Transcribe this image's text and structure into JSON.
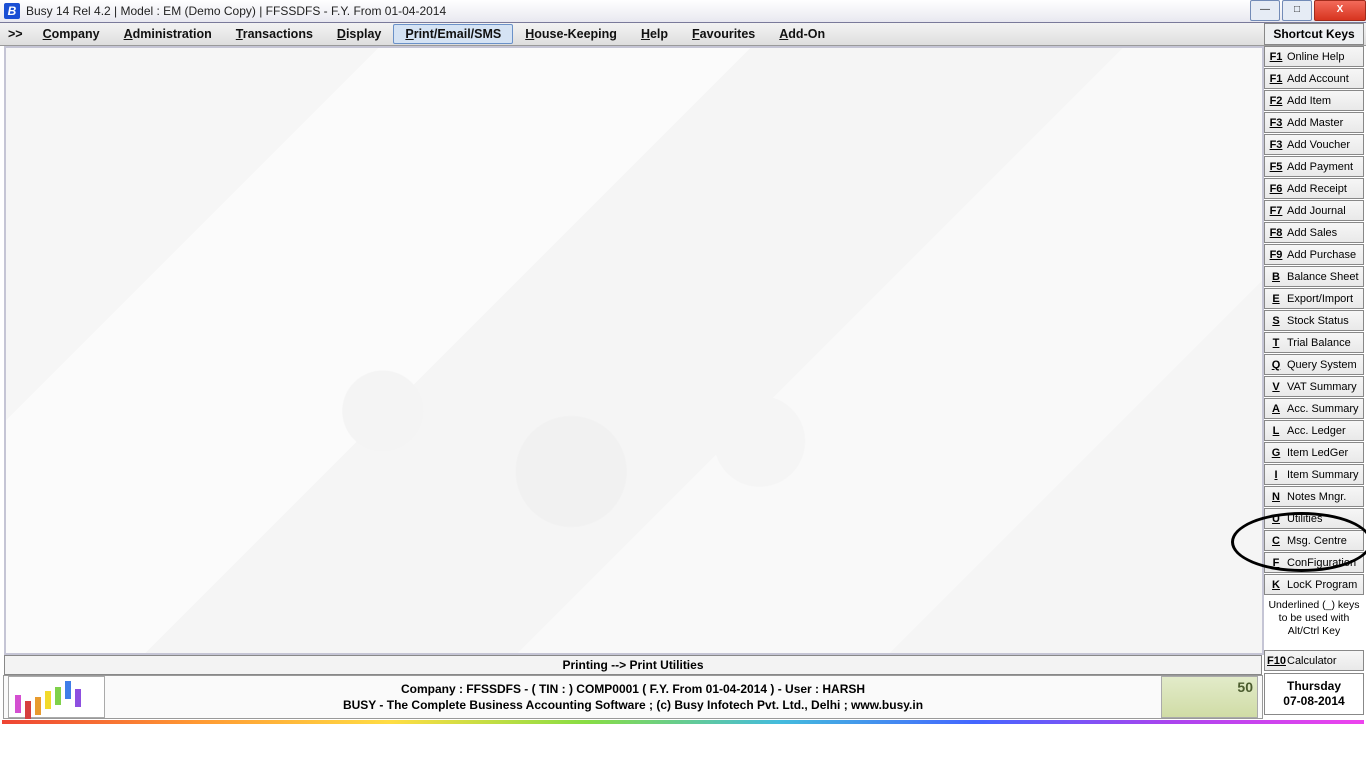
{
  "title": "Busy 14  Rel 4.2  |  Model : EM (Demo Copy)  |  FFSSDFS - F.Y. From 01-04-2014",
  "menu": {
    "dd": ">>",
    "items": [
      "Company",
      "Administration",
      "Transactions",
      "Display",
      "Print/Email/SMS",
      "House-Keeping",
      "Help",
      "Favourites",
      "Add-On"
    ],
    "selected_index": 4
  },
  "shortcuts": {
    "header": "Shortcut Keys",
    "list": [
      {
        "key": "F1",
        "label": "Online Help"
      },
      {
        "key": "F1",
        "label": "Add Account"
      },
      {
        "key": "F2",
        "label": "Add Item"
      },
      {
        "key": "F3",
        "label": "Add Master"
      },
      {
        "key": "F3",
        "label": "Add Voucher"
      },
      {
        "key": "F5",
        "label": "Add Payment"
      },
      {
        "key": "F6",
        "label": "Add Receipt"
      },
      {
        "key": "F7",
        "label": "Add Journal"
      },
      {
        "key": "F8",
        "label": "Add Sales"
      },
      {
        "key": "F9",
        "label": "Add Purchase"
      },
      {
        "key": "B",
        "label": "Balance Sheet"
      },
      {
        "key": "E",
        "label": "Export/Import"
      },
      {
        "key": "S",
        "label": "Stock Status"
      },
      {
        "key": "T",
        "label": "Trial Balance"
      },
      {
        "key": "Q",
        "label": "Query System"
      },
      {
        "key": "V",
        "label": "VAT Summary"
      },
      {
        "key": "A",
        "label": "Acc. Summary"
      },
      {
        "key": "L",
        "label": "Acc. Ledger"
      },
      {
        "key": "G",
        "label": "Item LedGer"
      },
      {
        "key": "I",
        "label": "Item Summary"
      },
      {
        "key": "N",
        "label": "Notes Mngr."
      },
      {
        "key": "U",
        "label": "Utilities"
      },
      {
        "key": "C",
        "label": "Msg. Centre"
      },
      {
        "key": "F",
        "label": "ConFiguration"
      },
      {
        "key": "K",
        "label": "LocK Program"
      }
    ],
    "note1": "Underlined (_) keys",
    "note2": "to be used with",
    "note3": "Alt/Ctrl Key",
    "calc_key": "F10",
    "calc_label": "Calculator",
    "day": "Thursday",
    "date": "07-08-2014"
  },
  "status": "Printing --> Print Utilities",
  "footer": {
    "line1": "Company : FFSSDFS - ( TIN :  ) COMP0001 ( F.Y. From 01-04-2014 ) - User : HARSH",
    "line2": "BUSY - The Complete Business Accounting Software   ;   (c) Busy Infotech Pvt. Ltd., Delhi  ;   www.busy.in"
  },
  "winctrl": {
    "min": "—",
    "max": "□",
    "close": "X"
  }
}
